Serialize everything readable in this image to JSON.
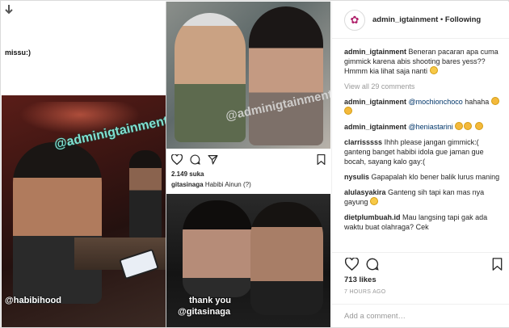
{
  "collage": {
    "top_left_text": "missu:)",
    "restaurant_watermark": "@adminigtainment",
    "restaurant_tag": "@habibihood",
    "embed": {
      "likes": "2.149 suka",
      "caption_user": "gitasinaga",
      "caption_text": "Habibi Ainun (?)"
    },
    "night_caption_line1": "thank you",
    "night_caption_line2": "@gitasinaga"
  },
  "header": {
    "username": "admin_igtainment",
    "separator": "•",
    "follow_label": "Following"
  },
  "comments": [
    {
      "user": "admin_igtainment",
      "text": "Beneran pacaran apa cuma gimmick karena abis shooting bares yess?? Hmmm kia lihat saja nanti"
    },
    {
      "user": "mochionchoco",
      "text": "hahaha"
    },
    {
      "user": "heniastarini",
      "text": ""
    },
    {
      "user": "clarrisssss",
      "text": "Ihhh please jangan gimmick:( ganteng banget habibi idola gue jaman gue bocah, sayang kalo gay:("
    },
    {
      "user": "nysulis",
      "text": "Gapapalah klo bener balik lurus maning"
    },
    {
      "user": "alulasyakira",
      "text": "Ganteng sih tapi kan mas nya gayung"
    },
    {
      "user": "dietplumbuah.id",
      "text": "Mau langsing tapi gak ada waktu buat olahraga? Cek"
    }
  ],
  "view_all": "View all 29 comments",
  "likes": "713 likes",
  "time_ago": "7 HOURS AGO",
  "add_comment_placeholder": "Add a comment…",
  "icons": {
    "heart": "heart-icon",
    "comment": "comment-icon",
    "share": "share-icon",
    "bookmark": "bookmark-icon",
    "down_arrow": "arrow-down-icon"
  }
}
